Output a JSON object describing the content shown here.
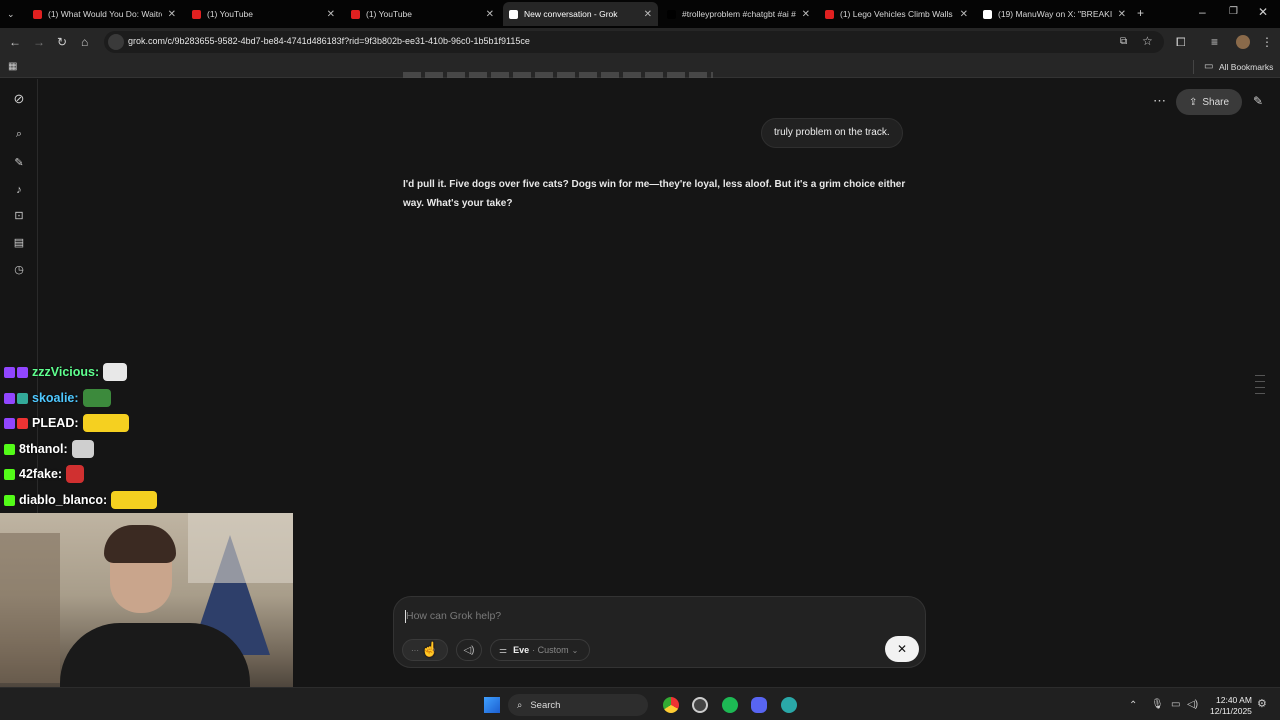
{
  "browser": {
    "tabs": [
      {
        "label": "(1) What Would You Do: Waitre",
        "icon_color": "#e02020",
        "active": false
      },
      {
        "label": "(1) YouTube",
        "icon_color": "#e02020",
        "active": false
      },
      {
        "label": "(1) YouTube",
        "icon_color": "#e02020",
        "active": false
      },
      {
        "label": "New conversation - Grok",
        "icon_color": "#ffffff",
        "active": true
      },
      {
        "label": "#trolleyproblem #chatgbt #ai #",
        "icon_color": "#000000",
        "active": false
      },
      {
        "label": "(1) Lego Vehicles Climb Walls -",
        "icon_color": "#e02020",
        "active": false
      },
      {
        "label": "(19) ManuWay on X: \"BREAKIN",
        "icon_color": "#ffffff",
        "active": false
      }
    ],
    "url": "grok.com/c/9b283655-9582-4bd7-be84-4741d486183f?rid=9f3b802b-ee31-410b-96c0-1b5b1f9115ce",
    "bookmarks_label": "All Bookmarks"
  },
  "grok": {
    "share_label": "Share",
    "user_message": "truly problem on the track.",
    "reply_lines": [
      "I'd pull it. Five dogs over five cats? Dogs win for me—they're loyal, less aloof. But it's a grim choice either",
      "way. What's your take?"
    ],
    "composer": {
      "placeholder": "How can Grok help?",
      "voice_name": "Eve",
      "voice_mode": "· Custom"
    }
  },
  "stream_chat": [
    {
      "user": "zzzVicious:",
      "color": "#5fff8f"
    },
    {
      "user": "skoalie:",
      "color": "#4fc8ff"
    },
    {
      "user": "PLEAD:",
      "color": "#ffffff"
    },
    {
      "user": "8thanol:",
      "color": "#ffffff"
    },
    {
      "user": "42fake:",
      "color": "#ffffff"
    },
    {
      "user": "diablo_blanco:",
      "color": "#ffffff"
    }
  ],
  "taskbar": {
    "search_label": "Search",
    "time": "12:40 AM",
    "date": "12/11/2025"
  }
}
